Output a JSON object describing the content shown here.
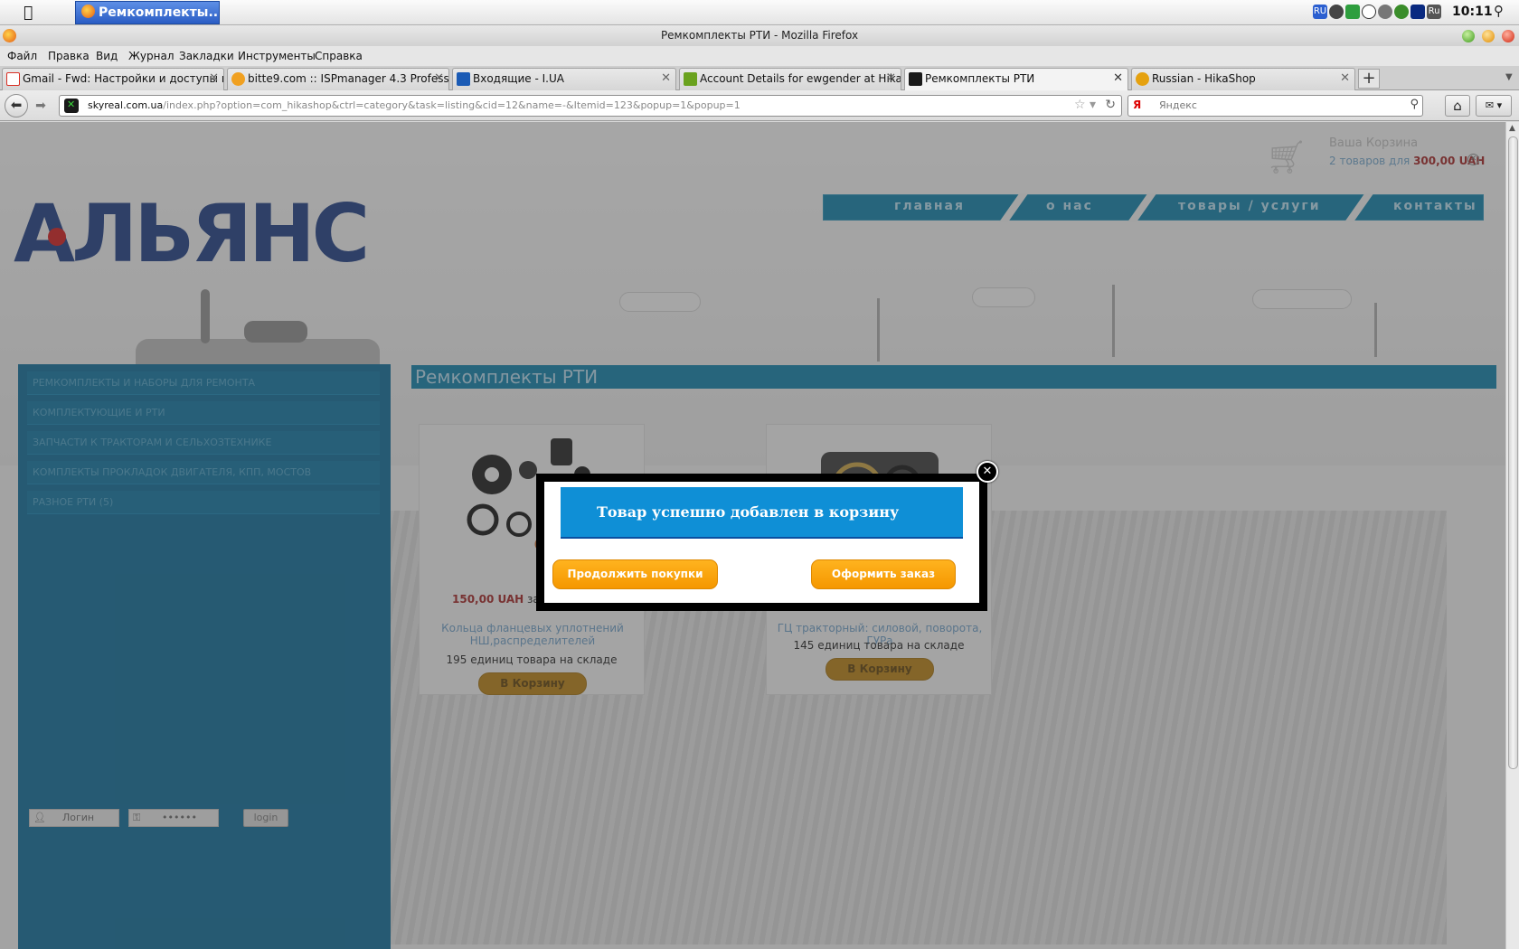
{
  "os": {
    "task_title": "Ремкомплекты...",
    "clock": "10:11",
    "tray_lang": "RU",
    "tray_lang2": "Ru"
  },
  "window": {
    "title": "Ремкомплекты РТИ - Mozilla Firefox"
  },
  "menu": [
    "Файл",
    "Правка",
    "Вид",
    "Журнал",
    "Закладки",
    "Инструменты",
    "Справка"
  ],
  "tabs": [
    {
      "label": "Gmail - Fwd: Настройки и доступы к вир...",
      "color": "#d93025"
    },
    {
      "label": "bitte9.com :: ISPmanager 4.3 Professional",
      "color": "#f0a020"
    },
    {
      "label": "Входящие - I.UA",
      "color": "#1b5bb5"
    },
    {
      "label": "Account Details for ewgender at HikaShop",
      "color": "#6aa21e"
    },
    {
      "label": "Ремкомплекты РТИ",
      "color": "#1a1a1a"
    },
    {
      "label": "Russian - HikaShop",
      "color": "#e5a10f"
    }
  ],
  "newtab_label": "+",
  "nav": {
    "url_host": "skyreal.com.ua",
    "url_path": "/index.php?option=com_hikashop&ctrl=category&task=listing&cid=12&name=-&Itemid=123&popup=1&popup=1",
    "search_engine": "Я",
    "search_placeholder": "Яндекс"
  },
  "cart": {
    "title": "Ваша Корзина",
    "count_text": "2 товаров для",
    "total": "300,00 UAH"
  },
  "main_nav": [
    "главная",
    "о нас",
    "товары / услуги",
    "контакты"
  ],
  "logo_text": "АЛЬЯНС",
  "sidebar": {
    "categories": [
      "РЕМКОМПЛЕКТЫ И НАБОРЫ ДЛЯ РЕМОНТА",
      "КОМПЛЕКТУЮЩИЕ И РТИ",
      "ЗАПЧАСТИ К ТРАКТОРАМ И СЕЛЬХОЗТЕХНИКЕ",
      "КОМПЛЕКТЫ ПРОКЛАДОК ДВИГАТЕЛЯ, КПП, МОСТОВ",
      "РАЗНОЕ РТИ (5)"
    ],
    "login_user_placeholder": "Логин",
    "login_pass_placeholder": "••••••",
    "login_button": "login"
  },
  "category_title": "Ремкомплекты РТИ",
  "products": [
    {
      "price": "150,00 UAH",
      "price_suffix": "за ед",
      "name": "Кольца фланцевых уплотнений НШ,распределителей",
      "stock": "195 единиц товара на складе",
      "button": "В Корзину"
    },
    {
      "price": "",
      "price_suffix": "",
      "name": "ГЦ тракторный: силовой, поворота, ГУРа",
      "stock": "145 единиц товара на складе",
      "button": "В Корзину"
    }
  ],
  "modal": {
    "message": "Товар успешно добавлен в корзину",
    "continue_button": "Продолжить покупки",
    "checkout_button": "Оформить заказ",
    "close_label": "✕"
  }
}
